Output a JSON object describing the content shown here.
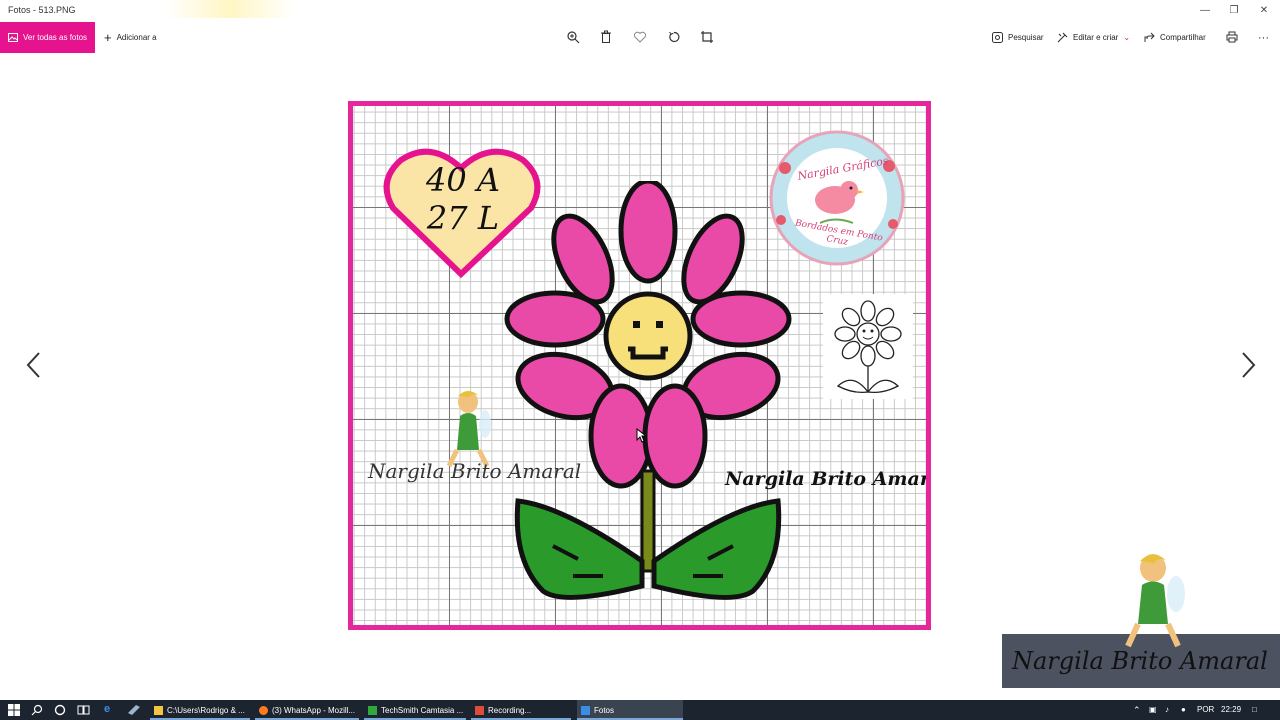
{
  "window": {
    "title": "Fotos - 513.PNG"
  },
  "toolbar": {
    "see_all_label": "Ver todas as fotos",
    "add_to_label": "Adicionar a",
    "search_label": "Pesquisar",
    "edit_create_label": "Editar e criar",
    "share_label": "Compartilhar"
  },
  "photo": {
    "size_line1": "40 A",
    "size_line2": "27 L",
    "logo_top_text": "Nargila Gráficos",
    "logo_bottom_text": "Bordados em Ponto Cruz",
    "signature_left": "Nargila Brito Amaral",
    "signature_right": "Nargila Brito Amaral"
  },
  "watermark": {
    "signature": "Nargila Brito Amaral"
  },
  "taskbar": {
    "tasks": [
      {
        "label": "C:\\Users\\Rodrigo & ...",
        "icon": "folder-icon"
      },
      {
        "label": "(3) WhatsApp - Mozill...",
        "icon": "firefox-icon"
      },
      {
        "label": "TechSmith Camtasia ...",
        "icon": "camtasia-icon"
      },
      {
        "label": "Recording...",
        "icon": "recording-icon"
      },
      {
        "label": "Fotos",
        "icon": "photos-icon"
      }
    ],
    "language": "POR",
    "clock": "22:29"
  },
  "colors": {
    "accent": "#e6138e",
    "frame": "#e4289c",
    "petal": "#e94aa8",
    "center": "#f7e07a",
    "leaf": "#2a9a2a",
    "stem": "#7a8a1a"
  }
}
